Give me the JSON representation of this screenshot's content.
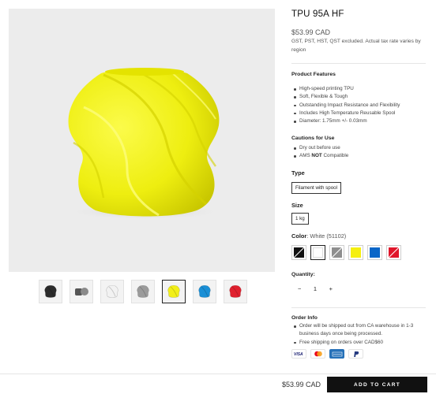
{
  "product": {
    "title": "TPU 95A HF",
    "price": "$53.99 CAD",
    "tax_note": "GST, PST, HST, QST excluded. Actual tax rate varies by region"
  },
  "gallery": {
    "main_color": "#f6f515",
    "thumbnails": [
      {
        "name": "black-spool",
        "color": "#2b2b2b"
      },
      {
        "name": "spool-hardware",
        "color": "#8a8a8a"
      },
      {
        "name": "white",
        "color": "#f2f2f2"
      },
      {
        "name": "gray",
        "color": "#9b9b9b"
      },
      {
        "name": "yellow",
        "color": "#f2ef18"
      },
      {
        "name": "blue",
        "color": "#1a8fd6"
      },
      {
        "name": "red",
        "color": "#e0202e"
      }
    ],
    "active_index": 4
  },
  "features": {
    "title": "Product Features",
    "items": [
      "High-speed printing TPU",
      "Soft, Flexible & Tough",
      "Outstanding Impact Resistance and Flexibility",
      "Includes High Temperature Reusable Spool",
      "Diameter: 1.75mm +/- 0.03mm"
    ]
  },
  "cautions": {
    "title": "Cautions for Use",
    "item1": "Dry out before use",
    "item2_prefix": "AMS ",
    "item2_bold": "NOT",
    "item2_suffix": " Compatible"
  },
  "options": {
    "type_label": "Type",
    "type_value": "Filament with spool",
    "size_label": "Size",
    "size_value": "1 kg",
    "color_label": "Color",
    "color_value": ": White (51102)",
    "swatches": [
      {
        "name": "black",
        "color": "#111111",
        "slash": true
      },
      {
        "name": "white",
        "color": "#ffffff",
        "slash": false
      },
      {
        "name": "gray",
        "color": "#8e8e8e",
        "slash": true
      },
      {
        "name": "yellow",
        "color": "#f5ef10",
        "slash": false
      },
      {
        "name": "blue",
        "color": "#0a66c8",
        "slash": false
      },
      {
        "name": "red",
        "color": "#e0152a",
        "slash": true
      }
    ],
    "active_swatch": 1
  },
  "quantity": {
    "label": "Quantity:",
    "minus": "−",
    "value": "1",
    "plus": "+"
  },
  "order_info": {
    "title": "Order Info",
    "items": [
      "Order will be shipped out from CA warehouse in 1-3 business days once being processed.",
      "Free shipping on orders over CAD$60"
    ]
  },
  "payment_icons": [
    "visa-icon",
    "mastercard-icon",
    "amex-icon",
    "paypal-icon"
  ],
  "bottom_bar": {
    "price": "$53.99 CAD",
    "cart_label": "ADD TO CART"
  }
}
